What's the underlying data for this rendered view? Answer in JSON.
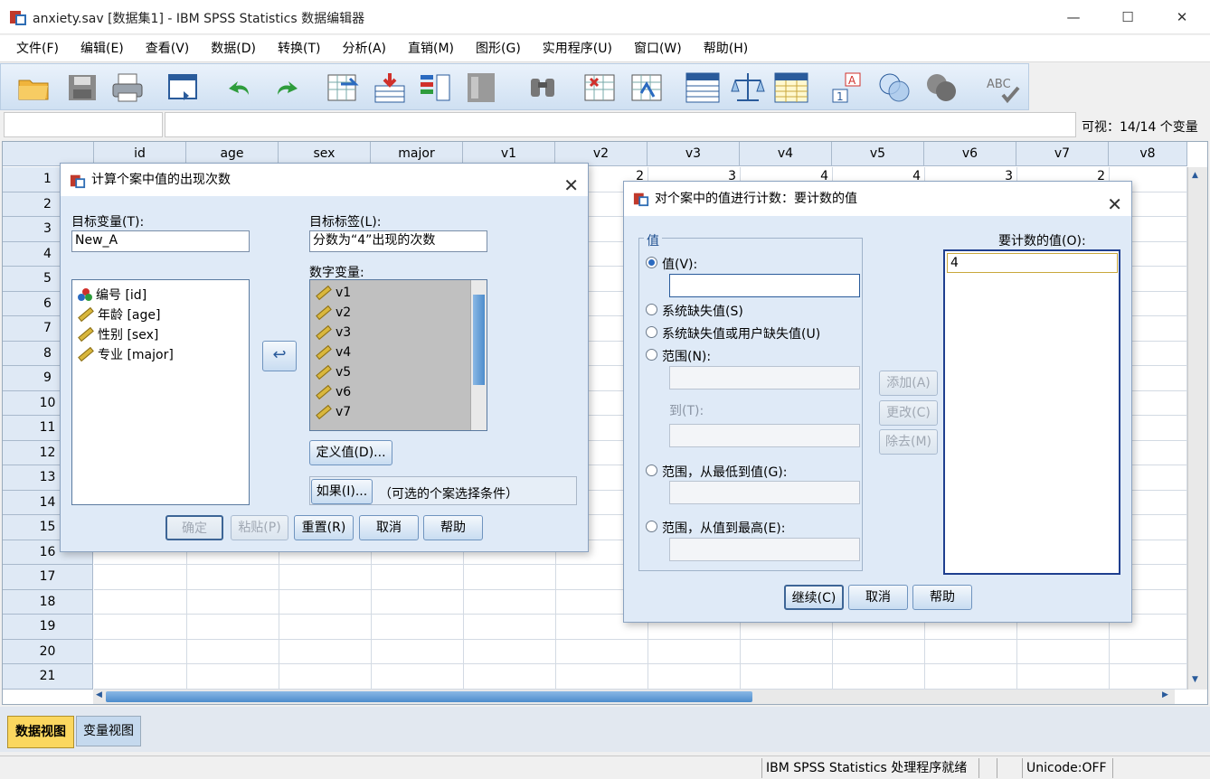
{
  "window": {
    "title": "anxiety.sav [数据集1] - IBM SPSS Statistics 数据编辑器",
    "min": "—",
    "max": "☐",
    "close": "✕"
  },
  "menu": [
    "文件(F)",
    "编辑(E)",
    "查看(V)",
    "数据(D)",
    "转换(T)",
    "分析(A)",
    "直销(M)",
    "图形(G)",
    "实用程序(U)",
    "窗口(W)",
    "帮助(H)"
  ],
  "toolbar_icons": [
    "open-folder-icon",
    "save-icon",
    "print-icon",
    "recall-dialog-icon",
    "undo-icon",
    "redo-icon",
    "goto-case-icon",
    "goto-variable-icon",
    "variables-icon",
    "run-descriptives-icon",
    "find-icon",
    "insert-cases-icon",
    "insert-variable-icon",
    "split-file-icon",
    "weight-cases-icon",
    "select-cases-icon",
    "value-labels-icon",
    "use-variable-sets-icon",
    "show-all-variables-icon",
    "spell-check-icon"
  ],
  "visible_text": "可视：14/14 个变量",
  "grid": {
    "columns": [
      "id",
      "age",
      "sex",
      "major",
      "v1",
      "v2",
      "v3",
      "v4",
      "v5",
      "v6",
      "v7",
      "v8"
    ],
    "rows": [
      "1",
      "2",
      "3",
      "4",
      "5",
      "6",
      "7",
      "8",
      "9",
      "10",
      "11",
      "12",
      "13",
      "14",
      "15",
      "16",
      "17",
      "18",
      "19",
      "20",
      "21"
    ],
    "row1_partial": [
      "2",
      "3",
      "4",
      "4",
      "3",
      "2"
    ]
  },
  "tabs": {
    "data_view": "数据视图",
    "variable_view": "变量视图"
  },
  "status": {
    "processor": "IBM SPSS Statistics 处理程序就绪",
    "unicode": "Unicode:OFF"
  },
  "count_dialog": {
    "title": "计算个案中值的出现次数",
    "target_var_label": "目标变量(T):",
    "target_var_value": "New_A",
    "target_label_label": "目标标签(L):",
    "target_label_value": "分数为“4”出现的次数",
    "numeric_vars_label": "数字变量:",
    "source_vars": [
      "编号 [id]",
      "年龄 [age]",
      "性别 [sex]",
      "专业 [major]"
    ],
    "numeric_vars": [
      "v1",
      "v2",
      "v3",
      "v4",
      "v5",
      "v6",
      "v7"
    ],
    "define_values": "定义值(D)...",
    "if_button": "如果(I)...",
    "if_hint": "（可选的个案选择条件）",
    "ok": "确定",
    "paste": "粘贴(P)",
    "reset": "重置(R)",
    "cancel": "取消",
    "help": "帮助"
  },
  "values_dialog": {
    "title": "对个案中的值进行计数：要计数的值",
    "group_label": "值",
    "value_option": "值(V):",
    "sysmis_option": "系统缺失值(S)",
    "sysmis_user_option": "系统缺失值或用户缺失值(U)",
    "range_option": "范围(N):",
    "to_label": "到(T):",
    "range_lowest_option": "范围，从最低到值(G):",
    "range_highest_option": "范围，从值到最高(E):",
    "values_to_count_label": "要计数的值(O):",
    "values_to_count": [
      "4"
    ],
    "add": "添加(A)",
    "change": "更改(C)",
    "remove": "除去(M)",
    "continue": "继续(C)",
    "cancel": "取消",
    "help": "帮助"
  }
}
